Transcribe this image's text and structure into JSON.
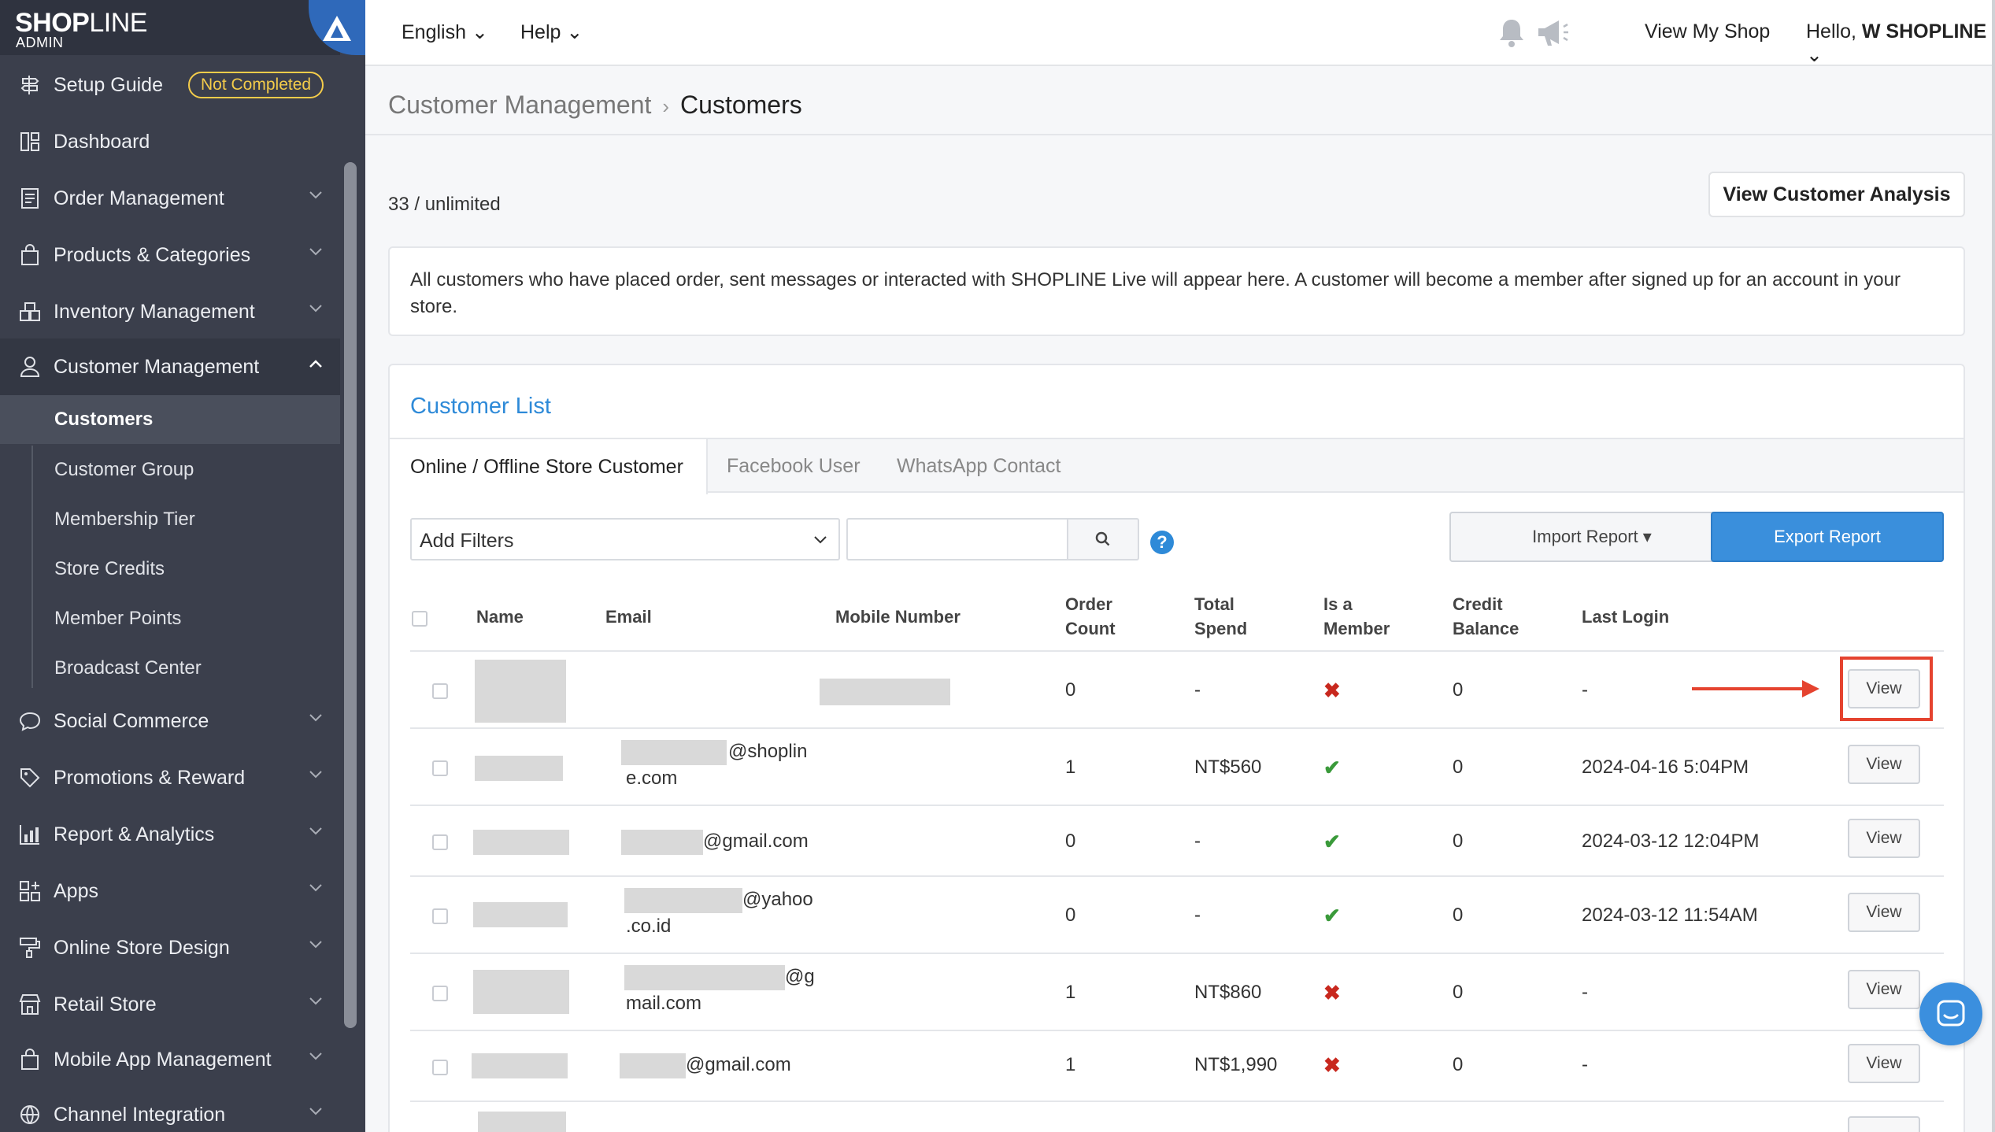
{
  "brand": {
    "name_bold": "SHOP",
    "name_light": "LINE",
    "sub": "ADMIN"
  },
  "sidebar": {
    "setup_guide": {
      "label": "Setup Guide",
      "badge": "Not Completed"
    },
    "items": [
      {
        "label": "Dashboard",
        "icon": "dashboard-icon"
      },
      {
        "label": "Order Management",
        "icon": "order-icon"
      },
      {
        "label": "Products & Categories",
        "icon": "bag-icon"
      },
      {
        "label": "Inventory Management",
        "icon": "inventory-icon"
      },
      {
        "label": "Customer Management",
        "icon": "user-icon"
      },
      {
        "label": "Social Commerce",
        "icon": "chat-icon"
      },
      {
        "label": "Promotions & Reward",
        "icon": "tag-icon"
      },
      {
        "label": "Report & Analytics",
        "icon": "chart-icon"
      },
      {
        "label": "Apps",
        "icon": "apps-icon"
      },
      {
        "label": "Online Store Design",
        "icon": "paint-icon"
      },
      {
        "label": "Retail Store",
        "icon": "store-icon"
      },
      {
        "label": "Mobile App Management",
        "icon": "mobile-bag-icon"
      },
      {
        "label": "Channel Integration",
        "icon": "globe-icon"
      }
    ],
    "sub_items": [
      "Customers",
      "Customer Group",
      "Membership Tier",
      "Store Credits",
      "Member Points",
      "Broadcast Center"
    ]
  },
  "topbar": {
    "language": "English",
    "help": "Help",
    "view_shop": "View My Shop",
    "greeting": "Hello,",
    "user": "W SHOPLINE"
  },
  "breadcrumb": {
    "parent": "Customer Management",
    "current": "Customers"
  },
  "count_text": "33 / unlimited",
  "analysis_button": "View Customer Analysis",
  "info_text": "All customers who have placed order, sent messages or interacted with SHOPLINE Live will appear here. A customer will become a member after signed up for an account in your store.",
  "panel": {
    "title": "Customer List",
    "tabs": [
      "Online / Offline Store Customer",
      "Facebook User",
      "WhatsApp Contact"
    ],
    "filter_placeholder": "Add Filters",
    "import_label": "Import Report ▾",
    "export_label": "Export Report",
    "help_mark": "?"
  },
  "table": {
    "headers": {
      "name": "Name",
      "email": "Email",
      "mobile": "Mobile Number",
      "order_count_1": "Order",
      "order_count_2": "Count",
      "total_spend_1": "Total",
      "total_spend_2": "Spend",
      "is_member_1": "Is a",
      "is_member_2": "Member",
      "credit_1": "Credit",
      "credit_2": "Balance",
      "last_login": "Last Login"
    },
    "view_label": "View",
    "rows": [
      {
        "email_1": "",
        "email_2": "",
        "order_count": "0",
        "total_spend": "-",
        "member": "✖",
        "credit": "0",
        "last_login": "-"
      },
      {
        "email_1": "@shoplin",
        "email_2": "e.com",
        "order_count": "1",
        "total_spend": "NT$560",
        "member": "✔",
        "credit": "0",
        "last_login": "2024-04-16 5:04PM"
      },
      {
        "email_1": "@gmail.com",
        "email_2": "",
        "order_count": "0",
        "total_spend": "-",
        "member": "✔",
        "credit": "0",
        "last_login": "2024-03-12 12:04PM"
      },
      {
        "email_1": "@yahoo",
        "email_2": ".co.id",
        "order_count": "0",
        "total_spend": "-",
        "member": "✔",
        "credit": "0",
        "last_login": "2024-03-12 11:54AM"
      },
      {
        "email_1": "@g",
        "email_2": "mail.com",
        "order_count": "1",
        "total_spend": "NT$860",
        "member": "✖",
        "credit": "0",
        "last_login": "-"
      },
      {
        "email_1": "@gmail.com",
        "email_2": "",
        "order_count": "1",
        "total_spend": "NT$1,990",
        "member": "✖",
        "credit": "0",
        "last_login": "-"
      }
    ]
  },
  "colors": {
    "sidebar": "#3b3f4c",
    "accent": "#2e8ad8",
    "export": "#3a8fdc",
    "highlight": "#e5432f",
    "badge": "#f4cc4a"
  }
}
